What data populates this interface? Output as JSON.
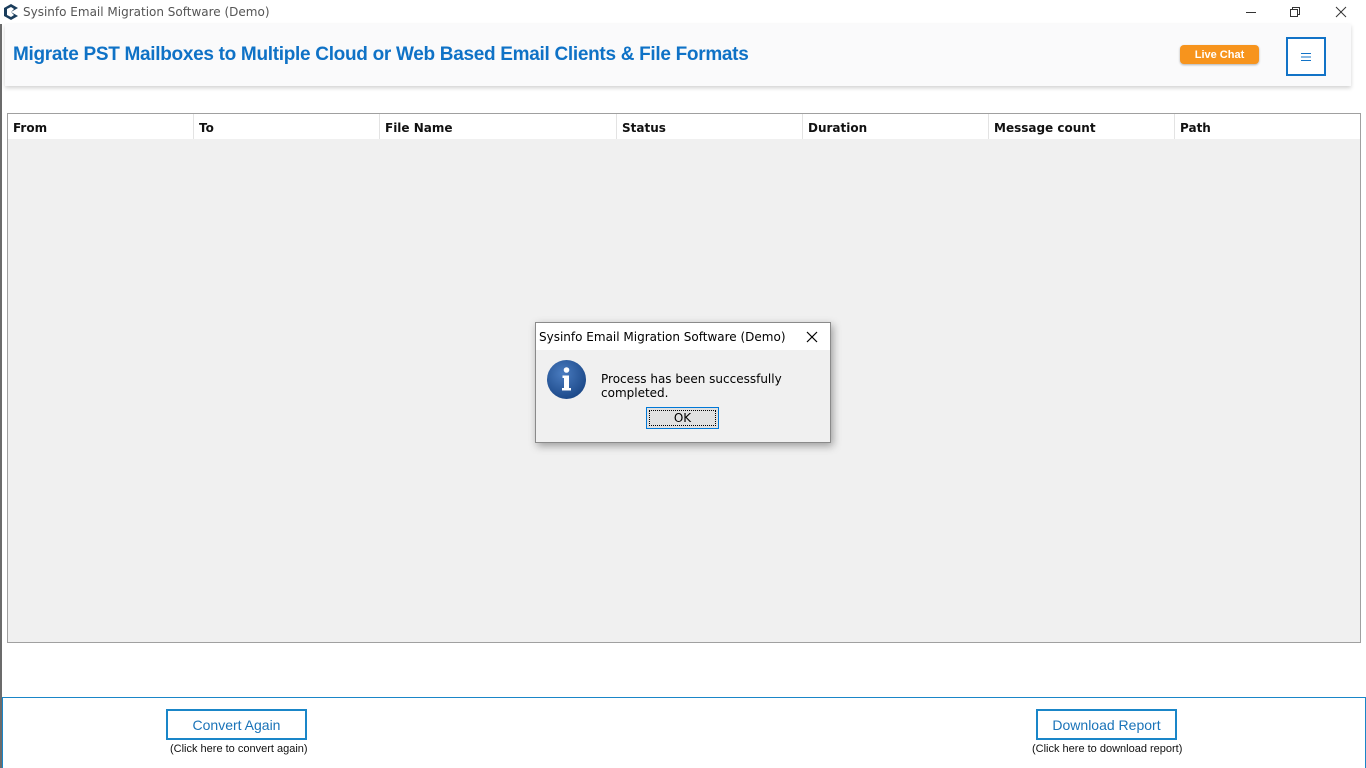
{
  "window": {
    "title": "Sysinfo Email Migration Software (Demo)"
  },
  "header": {
    "title": "Migrate PST Mailboxes to Multiple Cloud or Web Based Email Clients & File Formats",
    "live_chat_label": "Live Chat"
  },
  "table": {
    "columns": [
      {
        "label": "From"
      },
      {
        "label": "To"
      },
      {
        "label": "File Name"
      },
      {
        "label": "Status"
      },
      {
        "label": "Duration"
      },
      {
        "label": "Message count"
      },
      {
        "label": "Path"
      }
    ],
    "rows": []
  },
  "dialog": {
    "title": "Sysinfo Email Migration Software (Demo)",
    "message": "Process has been successfully completed.",
    "ok_label": "OK"
  },
  "footer": {
    "convert_again_label": "Convert Again",
    "convert_again_hint": "(Click here to convert again)",
    "download_report_label": "Download Report",
    "download_report_hint": "(Click here to download report)"
  },
  "colors": {
    "brand_blue": "#0f72c6",
    "live_chat_orange": "#f7941d",
    "footer_border": "#1a86c8"
  }
}
